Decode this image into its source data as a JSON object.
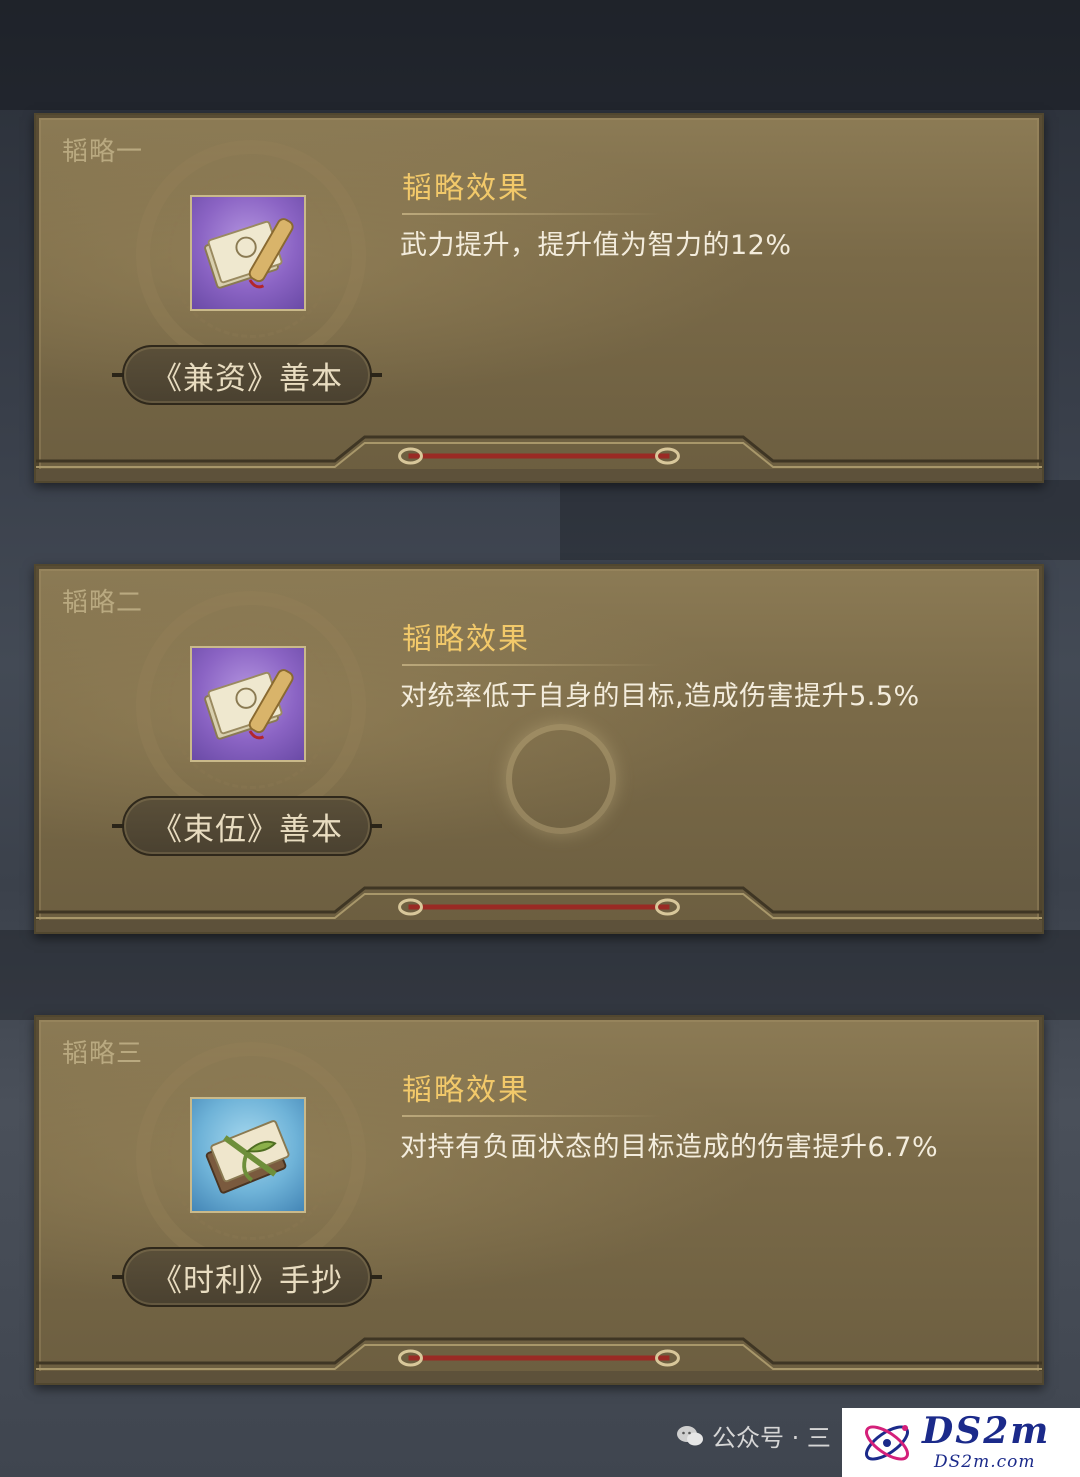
{
  "cards": [
    {
      "tag": "韬略一",
      "effect_title": "韬略效果",
      "effect_desc": "武力提升，提升值为智力的12%",
      "book_name": "《兼资》善本",
      "icon": "purple-book-scroll-icon"
    },
    {
      "tag": "韬略二",
      "effect_title": "韬略效果",
      "effect_desc": "对统率低于自身的目标,造成伤害提升5.5%",
      "book_name": "《束伍》善本",
      "icon": "purple-book-scroll-icon"
    },
    {
      "tag": "韬略三",
      "effect_title": "韬略效果",
      "effect_desc": "对持有负面状态的目标造成的伤害提升6.7%",
      "book_name": "《时利》手抄",
      "icon": "blue-bamboo-book-icon"
    }
  ],
  "watermark": {
    "text": "公众号 · 三",
    "icon": "wechat-icon"
  },
  "logo": {
    "main": "DS2m",
    "sub": "DS2m.com"
  },
  "colors": {
    "card_bg": "#7a6a48",
    "effect_title": "#f2c96a",
    "rail_red": "#9a2a24"
  }
}
